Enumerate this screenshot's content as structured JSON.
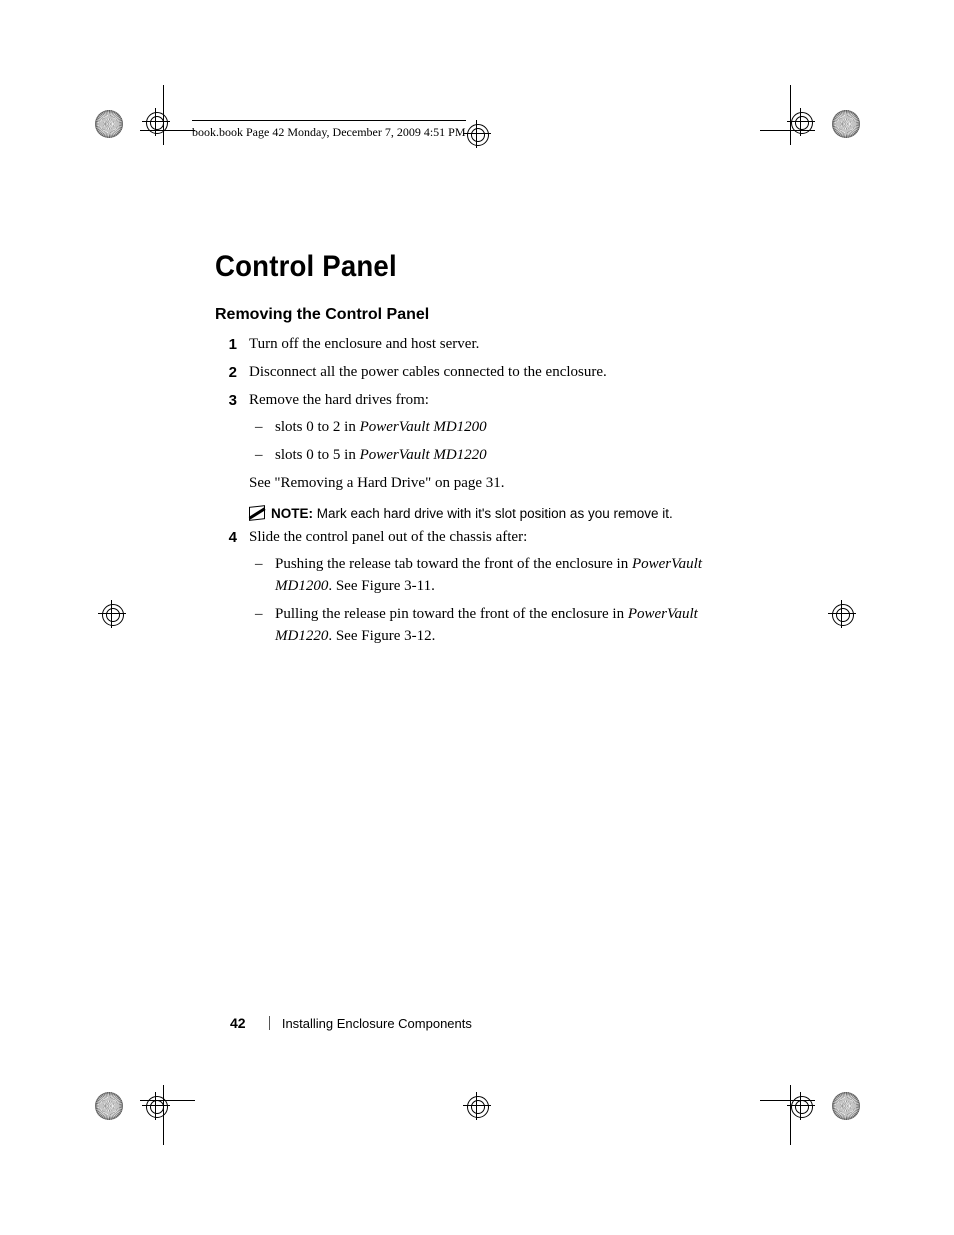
{
  "running_head": "book.book  Page 42  Monday, December 7, 2009  4:51 PM",
  "section_title": "Control Panel",
  "subsection_title": "Removing the Control Panel",
  "steps": {
    "s1": {
      "num": "1",
      "text": "Turn off the enclosure and host server."
    },
    "s2": {
      "num": "2",
      "text": "Disconnect all the power cables connected to the enclosure."
    },
    "s3": {
      "num": "3",
      "lead": "Remove the hard drives from:",
      "bullets": {
        "b1_pre": "slots 0 to 2 in ",
        "b1_em": "PowerVault MD1200",
        "b2_pre": "slots 0 to 5 in ",
        "b2_em": "PowerVault MD1220"
      },
      "see": "See \"Removing a Hard Drive\" on page 31."
    },
    "s4": {
      "num": "4",
      "lead": "Slide the control panel out of the chassis after:",
      "bullets": {
        "b1_pre": "Pushing the release tab toward the front of the enclosure in ",
        "b1_em": "PowerVault MD1200",
        "b1_post": ". See Figure 3-11.",
        "b2_pre": "Pulling the release pin toward the front of the enclosure in ",
        "b2_em": "PowerVault MD1220",
        "b2_post": ". See Figure 3-12."
      }
    }
  },
  "note": {
    "label": "NOTE:",
    "text": " Mark each hard drive with it's slot position as you remove it."
  },
  "footer": {
    "page": "42",
    "chapter": "Installing Enclosure Components"
  }
}
